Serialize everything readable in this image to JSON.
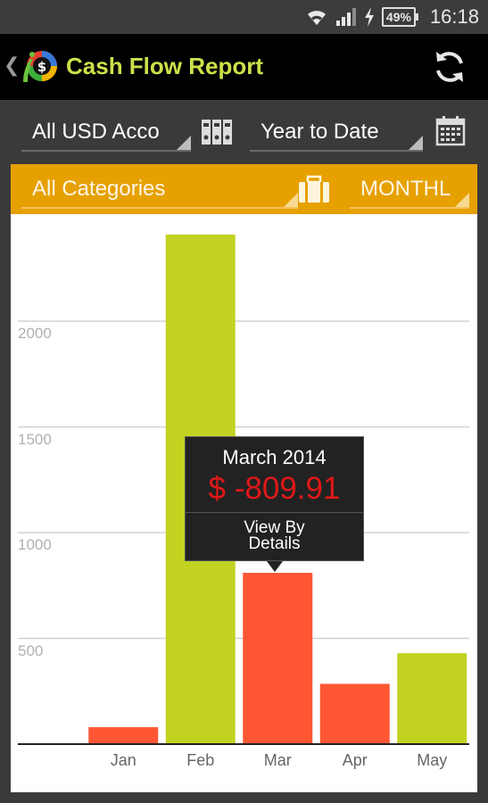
{
  "status_bar": {
    "battery": "49%",
    "time": "16:18"
  },
  "app_bar": {
    "title": "Cash Flow Report",
    "accent": "#cde04a"
  },
  "filters": {
    "account": "All USD Acco",
    "date_range": "Year to Date"
  },
  "category_bar": {
    "category": "All Categories",
    "period": "MONTHL",
    "color": "#e6a000"
  },
  "tooltip": {
    "title": "March 2014",
    "value": "$ -809.91",
    "link": [
      "View By",
      "Details"
    ]
  },
  "chart_data": {
    "type": "bar",
    "categories": [
      "Jan",
      "Feb",
      "Mar",
      "Apr",
      "May"
    ],
    "values": [
      -80,
      2410,
      -810,
      -285,
      430
    ],
    "colors": {
      "positive": "#c2d322",
      "negative": "#ff5733"
    },
    "yticks": [
      500,
      1000,
      1500,
      2000
    ],
    "ylim": [
      0,
      2500
    ],
    "grid": true
  }
}
